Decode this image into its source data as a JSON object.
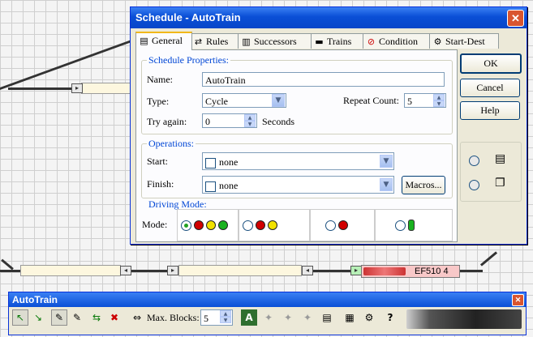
{
  "layout": {
    "blocks": [
      {
        "label": ""
      },
      {
        "label": ""
      },
      {
        "label": ""
      },
      {
        "label": ""
      }
    ],
    "loco": {
      "label": "EF510 4"
    }
  },
  "dialog": {
    "title": "Schedule - AutoTrain",
    "close": "✕",
    "tabs": [
      {
        "label": "General",
        "icon": "▤"
      },
      {
        "label": "Rules",
        "icon": "⇄"
      },
      {
        "label": "Successors",
        "icon": "▥"
      },
      {
        "label": "Trains",
        "icon": "▬"
      },
      {
        "label": "Condition",
        "icon": "⊘"
      },
      {
        "label": "Start-Dest",
        "icon": "⚙"
      }
    ],
    "props": {
      "legend": "Schedule Properties:",
      "name_label": "Name:",
      "name_value": "AutoTrain",
      "type_label": "Type:",
      "type_value": "Cycle",
      "repeat_label": "Repeat Count:",
      "repeat_value": "5",
      "try_label": "Try again:",
      "try_value": "0",
      "seconds": "Seconds"
    },
    "ops": {
      "legend": "Operations:",
      "start_label": "Start:",
      "start_value": "none",
      "finish_label": "Finish:",
      "finish_value": "none",
      "macros": "Macros..."
    },
    "drive": {
      "legend": "Driving Mode:",
      "mode_label": "Mode:"
    },
    "buttons": {
      "ok": "OK",
      "cancel": "Cancel",
      "help": "Help"
    }
  },
  "toolbar": {
    "title": "AutoTrain",
    "close": "✕",
    "max_blocks_label": "Max. Blocks:",
    "max_blocks_value": "5",
    "icons": [
      "↖",
      "↘",
      "✎",
      "✎",
      "⇆",
      "✖",
      "⇔"
    ]
  },
  "colors": {
    "tab_accent": "#f1b81a",
    "legend_blue": "#0046d5",
    "title_blue": "#0a4fd6",
    "signal_red": "#d10000",
    "signal_yellow": "#f2e200",
    "signal_green": "#19b21f",
    "loco_pink": "#f8c8c8"
  }
}
